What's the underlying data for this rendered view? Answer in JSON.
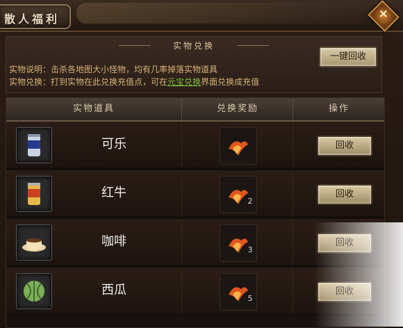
{
  "window": {
    "title_tab": "散人福利",
    "close_icon": "diamond-close-icon"
  },
  "info": {
    "header": "实物兑换",
    "recycle_all_label": "一键回收",
    "line1": "实物说明：击杀各地图大小怪物，均有几率掉落实物道具",
    "line2_prefix": "实物兑换：打到实物在此兑换充值点，可在",
    "line2_link": "元宝兑换",
    "line2_suffix": "界面兑换成充值"
  },
  "table": {
    "headers": [
      "实物道具",
      "兑换奖励",
      "操作"
    ],
    "rows": [
      {
        "name": "可乐",
        "icon": "cola-can-icon",
        "reward_icon": "phoenix-fire-icon",
        "count": "",
        "action": "回收"
      },
      {
        "name": "红牛",
        "icon": "energy-drink-can-icon",
        "reward_icon": "phoenix-fire-icon",
        "count": "2",
        "action": "回收"
      },
      {
        "name": "咖啡",
        "icon": "coffee-cup-icon",
        "reward_icon": "phoenix-fire-icon",
        "count": "3",
        "action": "回收"
      },
      {
        "name": "西瓜",
        "icon": "watermelon-icon",
        "reward_icon": "phoenix-fire-icon",
        "count": "5",
        "action": "回收"
      }
    ]
  }
}
